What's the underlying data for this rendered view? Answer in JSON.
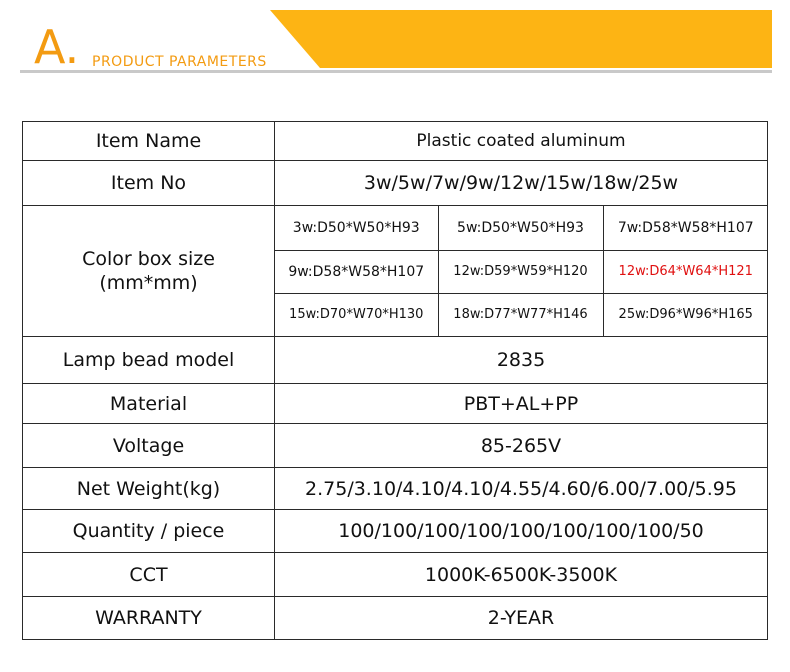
{
  "header": {
    "letter": "A.",
    "title": "PRODUCT  PARAMETERS"
  },
  "rows": {
    "item_name": {
      "label": "Item Name",
      "value": "Plastic coated aluminum"
    },
    "item_no": {
      "label": "Item No",
      "value": "3w/5w/7w/9w/12w/15w/18w/25w"
    },
    "color_box": {
      "label_line1": "Color box size",
      "label_line2": "(mm*mm)",
      "cells": [
        [
          "3w:D50*W50*H93",
          "5w:D50*W50*H93",
          "7w:D58*W58*H107"
        ],
        [
          "9w:D58*W58*H107",
          "12w:D59*W59*H120",
          "12w:D64*W64*H121"
        ],
        [
          "15w:D70*W70*H130",
          "18w:D77*W77*H146",
          "25w:D96*W96*H165"
        ]
      ],
      "highlight_color": "#e01010"
    },
    "lamp_bead": {
      "label": "Lamp bead model",
      "value": "2835"
    },
    "material": {
      "label": "Material",
      "value": "PBT+AL+PP"
    },
    "voltage": {
      "label": "Voltage",
      "value": "85-265V"
    },
    "net_weight": {
      "label": "Net Weight(kg)",
      "value": "2.75/3.10/4.10/4.10/4.55/4.60/6.00/7.00/5.95"
    },
    "quantity": {
      "label": "Quantity / piece",
      "value": "100/100/100/100/100/100/100/100/50"
    },
    "cct": {
      "label": "CCT",
      "value": "1000K-6500K-3500K"
    },
    "warranty": {
      "label": "WARRANTY",
      "value": "2-YEAR"
    }
  },
  "colors": {
    "accent": "#fdb414",
    "accent_text": "#f39b12",
    "divider": "#c9c9c9"
  }
}
